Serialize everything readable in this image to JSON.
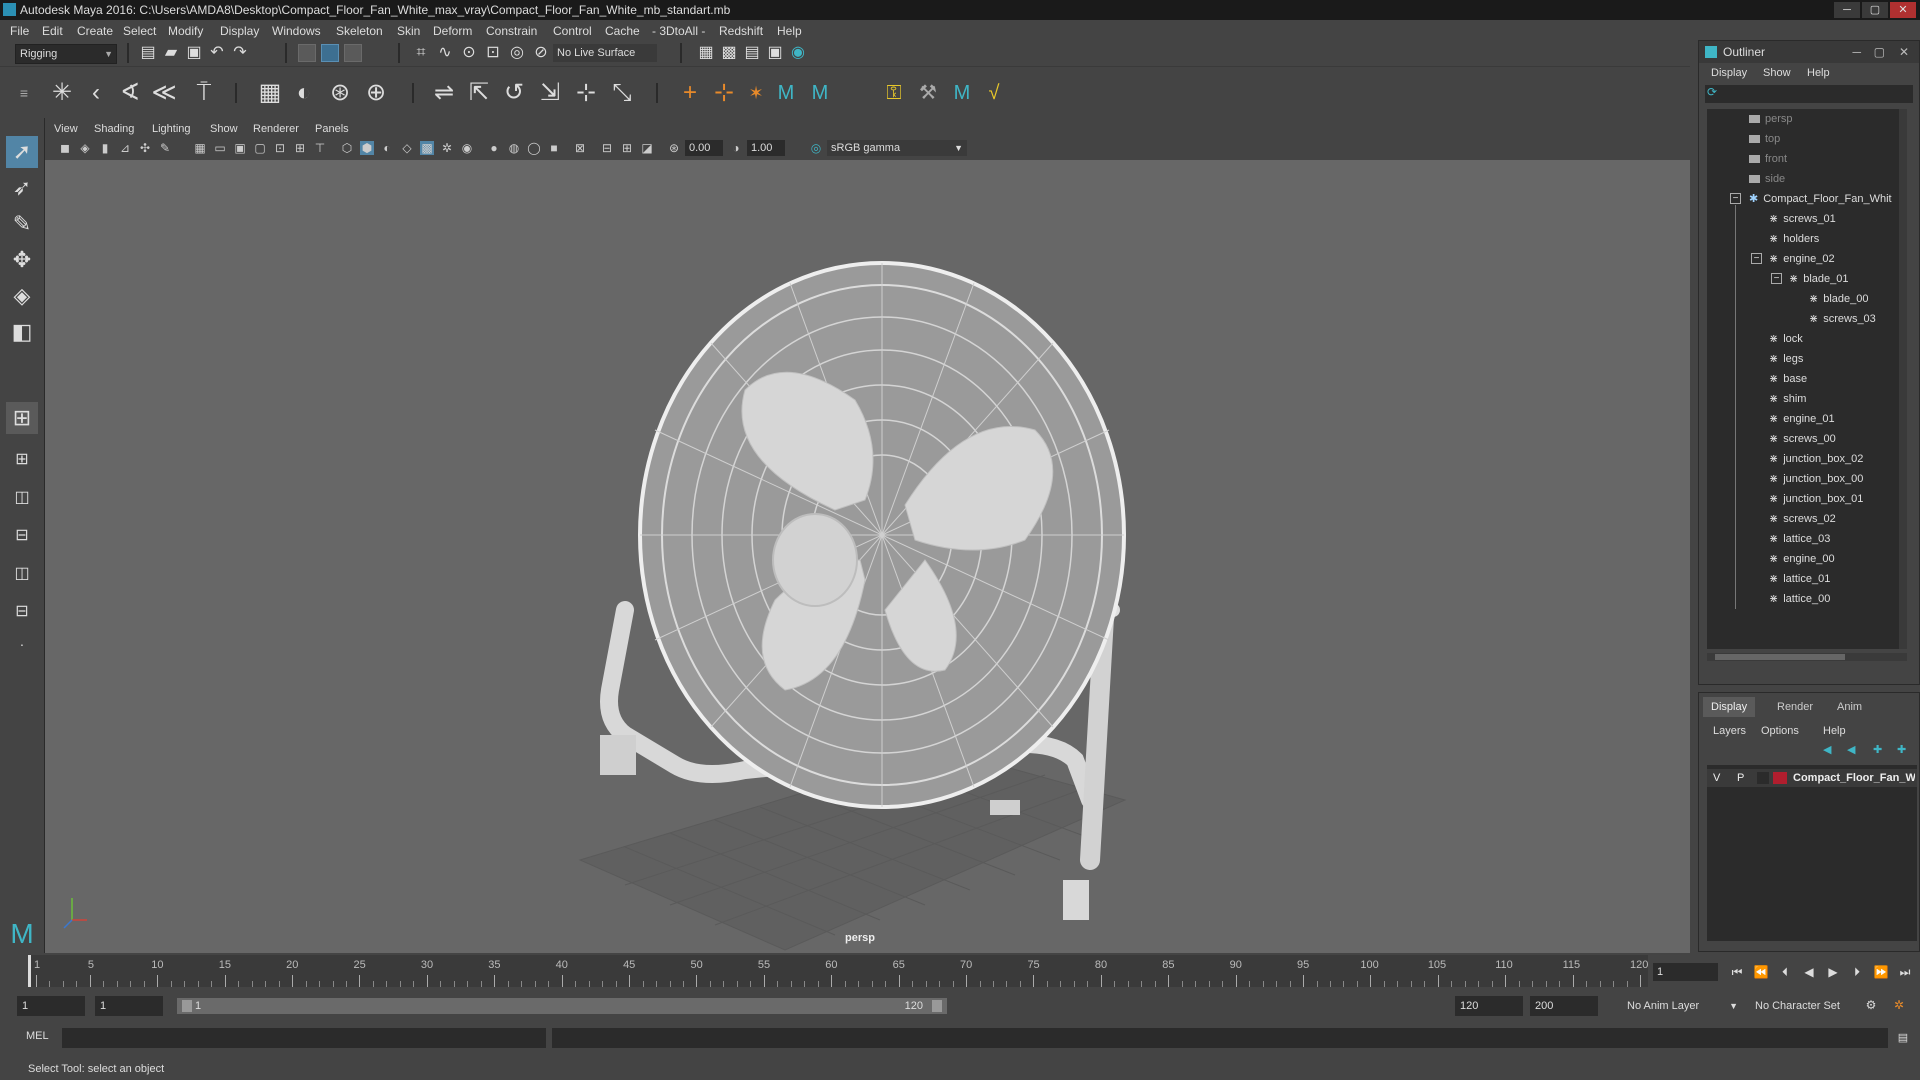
{
  "window": {
    "title": "Autodesk Maya 2016: C:\\Users\\AMDA8\\Desktop\\Compact_Floor_Fan_White_max_vray\\Compact_Floor_Fan_White_mb_standart.mb",
    "buttons": [
      "─",
      "▢",
      "✕"
    ]
  },
  "menubar": [
    "File",
    "Edit",
    "Create",
    "Select",
    "Modify",
    "Display",
    "Windows",
    "Skeleton",
    "Skin",
    "Deform",
    "Constrain",
    "Control",
    "Cache",
    "- 3DtoAll -",
    "Redshift",
    "Help"
  ],
  "status_line": {
    "menuset": "Rigging",
    "live_surface": "No Live Surface"
  },
  "viewport": {
    "menu": [
      "View",
      "Shading",
      "Lighting",
      "Show",
      "Renderer",
      "Panels"
    ],
    "exposure": "0.00",
    "gamma": "1.00",
    "colorspace": "sRGB gamma",
    "camera_label": "persp"
  },
  "outliner": {
    "title": "Outliner",
    "menu": [
      "Display",
      "Show",
      "Help"
    ],
    "cameras": [
      "persp",
      "top",
      "front",
      "side"
    ],
    "root": "Compact_Floor_Fan_Whit",
    "children_top": [
      "screws_01",
      "holders"
    ],
    "engine_02": "engine_02",
    "blade_01": "blade_01",
    "blade_children": [
      "blade_00",
      "screws_03"
    ],
    "children_rest": [
      "lock",
      "legs",
      "base",
      "shim",
      "engine_01",
      "screws_00",
      "junction_box_02",
      "junction_box_00",
      "junction_box_01",
      "screws_02",
      "lattice_03",
      "engine_00",
      "lattice_01",
      "lattice_00"
    ]
  },
  "layer_editor": {
    "tabs": [
      "Display",
      "Render",
      "Anim"
    ],
    "menu": [
      "Layers",
      "Options",
      "Help"
    ],
    "layer": {
      "v": "V",
      "p": "P",
      "name": "Compact_Floor_Fan_W",
      "color": "#b01e2e"
    }
  },
  "timeline": {
    "ticks": [
      1,
      5,
      10,
      15,
      20,
      25,
      30,
      35,
      40,
      45,
      50,
      55,
      60,
      65,
      70,
      75,
      80,
      85,
      90,
      95,
      100,
      105,
      110,
      115,
      120
    ],
    "current_frame": "1"
  },
  "range": {
    "start": "1",
    "playback_start": "1",
    "bar_start": "1",
    "bar_end": "120",
    "playback_end": "120",
    "end": "200",
    "anim_layer": "No Anim Layer",
    "character_set": "No Character Set"
  },
  "command_line": {
    "label": "MEL"
  },
  "help_line": "Select Tool: select an object",
  "colors": {
    "accent": "#5285a6",
    "maya_teal": "#3fb6c6",
    "layer_red": "#b01e2e"
  }
}
